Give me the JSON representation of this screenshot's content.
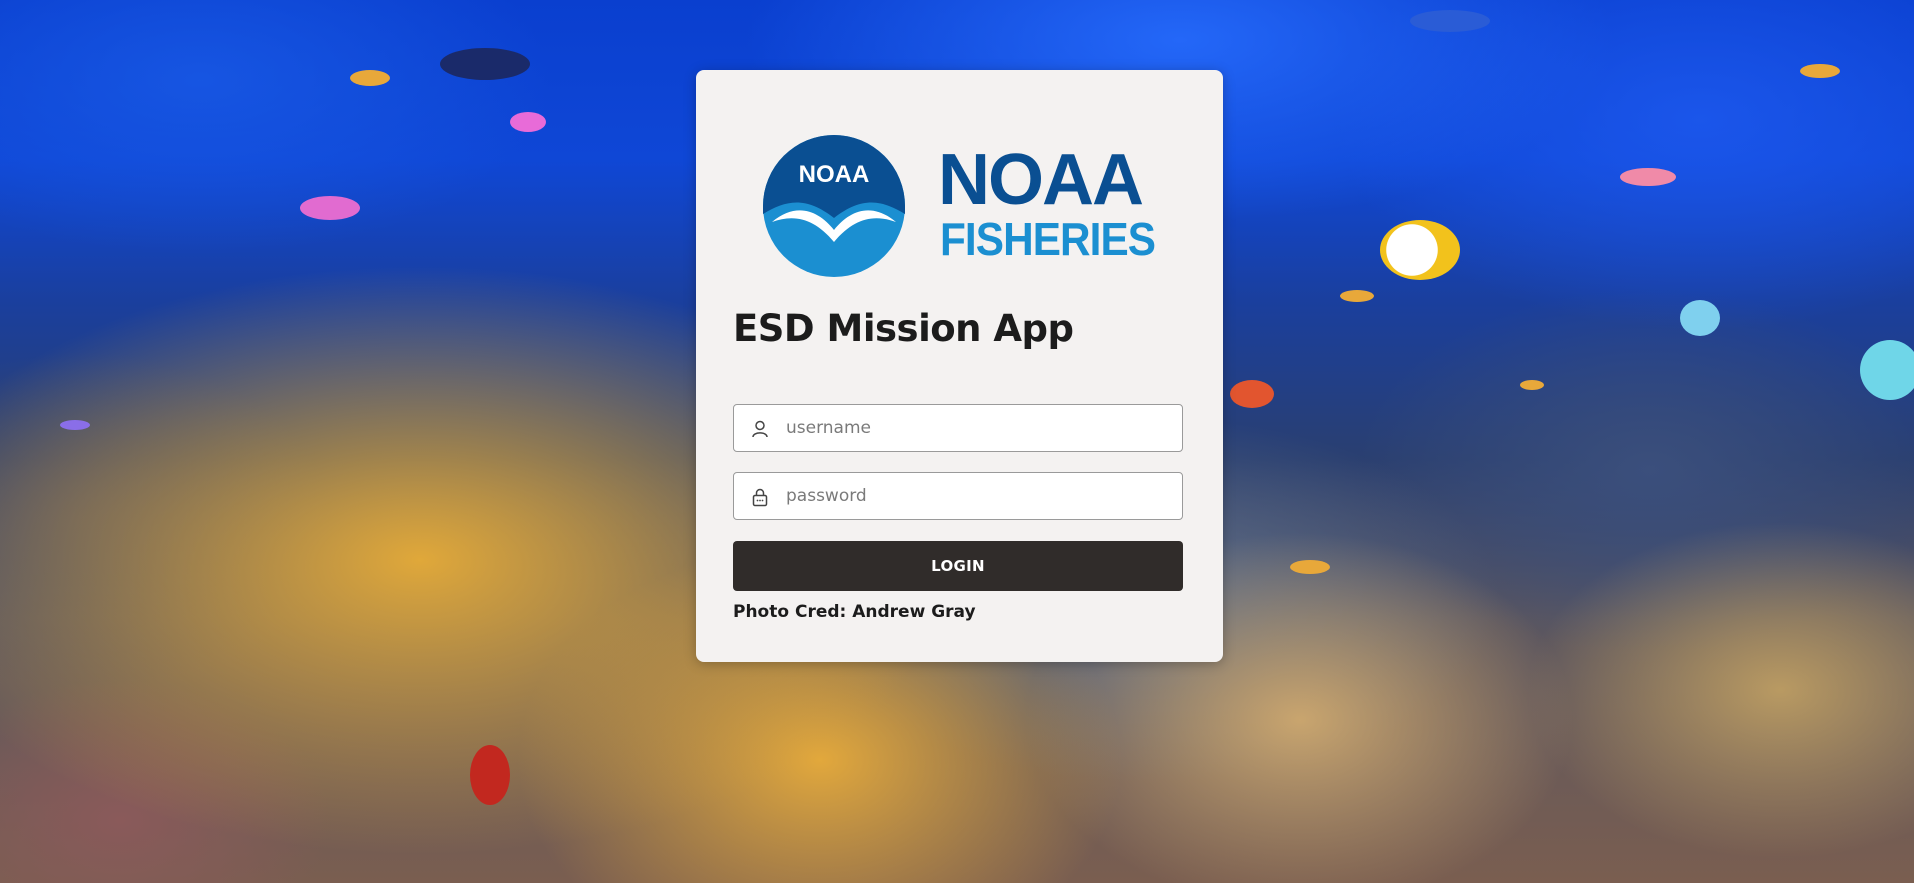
{
  "background": {
    "description_icon": "coral-reef-photo",
    "water_color": "#0f47d6"
  },
  "logo": {
    "emblem_text": "NOAA",
    "wordmark_line1": "NOAA",
    "wordmark_line2": "FISHERIES",
    "primary_color": "#0a4f92",
    "secondary_color": "#1b8fd1"
  },
  "app": {
    "title": "ESD Mission App"
  },
  "form": {
    "username_placeholder": "username",
    "username_icon": "user-icon",
    "password_placeholder": "password",
    "password_icon": "lock-icon",
    "login_label": "LOGIN"
  },
  "footer": {
    "photo_credit": "Photo Cred: Andrew Gray"
  },
  "colors": {
    "card_bg": "#f4f2f1",
    "button_bg": "#302c2a",
    "button_text": "#ffffff"
  }
}
